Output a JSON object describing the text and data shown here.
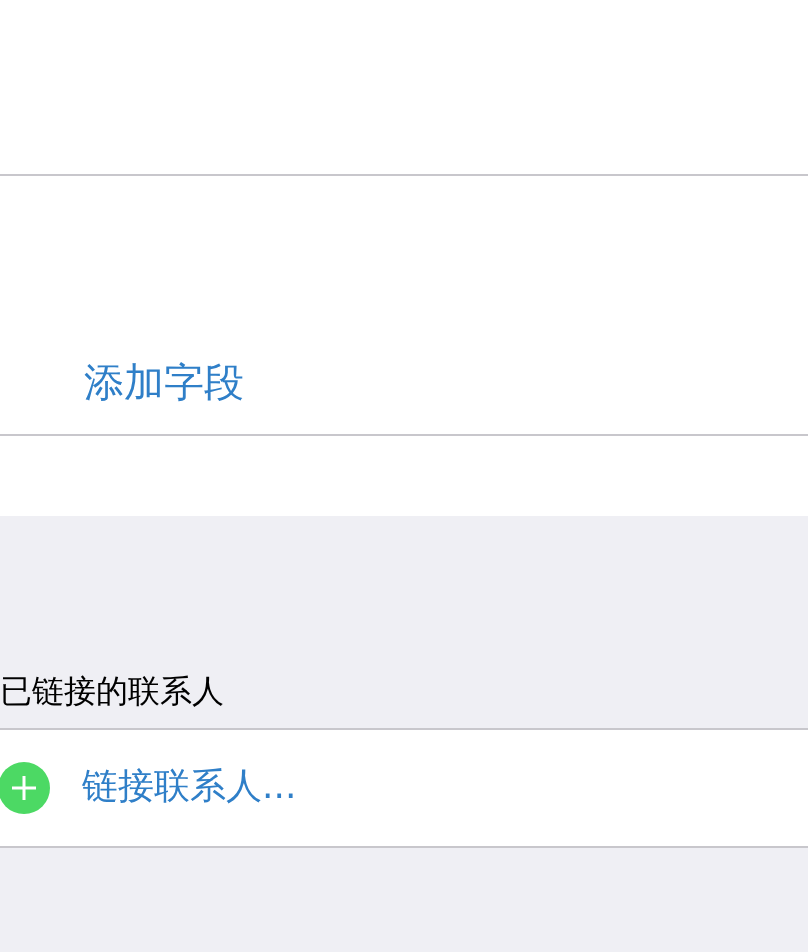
{
  "add_field": {
    "label": "添加字段"
  },
  "linked_contacts": {
    "header": "已链接的联系人",
    "action": "链接联系人..."
  }
}
